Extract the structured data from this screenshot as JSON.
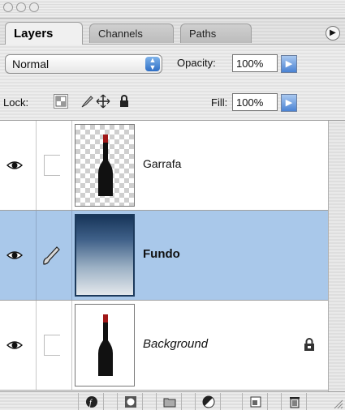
{
  "tabs": [
    {
      "label": "Layers",
      "active": true
    },
    {
      "label": "Channels",
      "active": false
    },
    {
      "label": "Paths",
      "active": false
    }
  ],
  "options": {
    "blend_mode": "Normal",
    "opacity_label": "Opacity:",
    "opacity_value": "100%",
    "lock_label": "Lock:",
    "fill_label": "Fill:",
    "fill_value": "100%"
  },
  "layers": [
    {
      "name": "Garrafa",
      "visible": true,
      "selected": false,
      "style": "normal",
      "thumb": "bottle-transparent",
      "locked": false
    },
    {
      "name": "Fundo",
      "visible": true,
      "selected": true,
      "style": "bold",
      "thumb": "gradient",
      "locked": false
    },
    {
      "name": "Background",
      "visible": true,
      "selected": false,
      "style": "italic",
      "thumb": "bottle-white",
      "locked": true
    }
  ],
  "bottom_tools": [
    "layer-style-icon",
    "layer-mask-icon",
    "layer-set-folder-icon",
    "adjustment-layer-icon",
    "new-layer-icon",
    "trash-icon"
  ],
  "colors": {
    "selection": "#a9c8ea",
    "accent": "#3a78cf"
  }
}
